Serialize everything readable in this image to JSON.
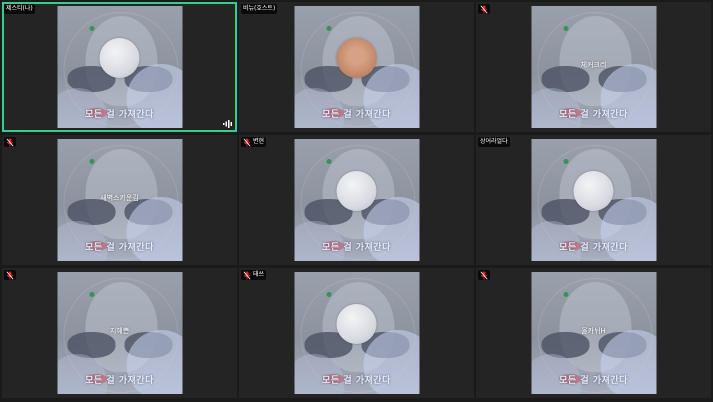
{
  "video_caption": "모든 걸 가져간다",
  "tiles": [
    {
      "name": "제스티(나)",
      "overlay": "",
      "mic_muted": false,
      "active": true,
      "avatar": "plain",
      "speaking_icon": "audio-level-icon"
    },
    {
      "name": "비뉴(호스트)",
      "overlay": "",
      "mic_muted": false,
      "active": false,
      "avatar": "photo"
    },
    {
      "name": "",
      "overlay": "체커크리",
      "mic_muted": true,
      "active": false,
      "avatar": "none"
    },
    {
      "name": "",
      "overlay": "새벽스키운김",
      "mic_muted": true,
      "active": false,
      "avatar": "none"
    },
    {
      "name": "변현",
      "overlay": "",
      "mic_muted": true,
      "active": false,
      "avatar": "plain"
    },
    {
      "name": "상어라얼다",
      "overlay": "",
      "mic_muted": false,
      "active": false,
      "avatar": "plain"
    },
    {
      "name": "",
      "overlay": "지혜쁜",
      "mic_muted": true,
      "active": false,
      "avatar": "none"
    },
    {
      "name": "태쓰",
      "overlay": "",
      "mic_muted": true,
      "active": false,
      "avatar": "plain"
    },
    {
      "name": "",
      "overlay": "올카뉘H",
      "mic_muted": true,
      "active": false,
      "avatar": "none"
    }
  ],
  "colors": {
    "active_border": "#3ad84a",
    "muted_mic": "#e02828",
    "background": "#1a1a1a",
    "tile": "#242424"
  }
}
